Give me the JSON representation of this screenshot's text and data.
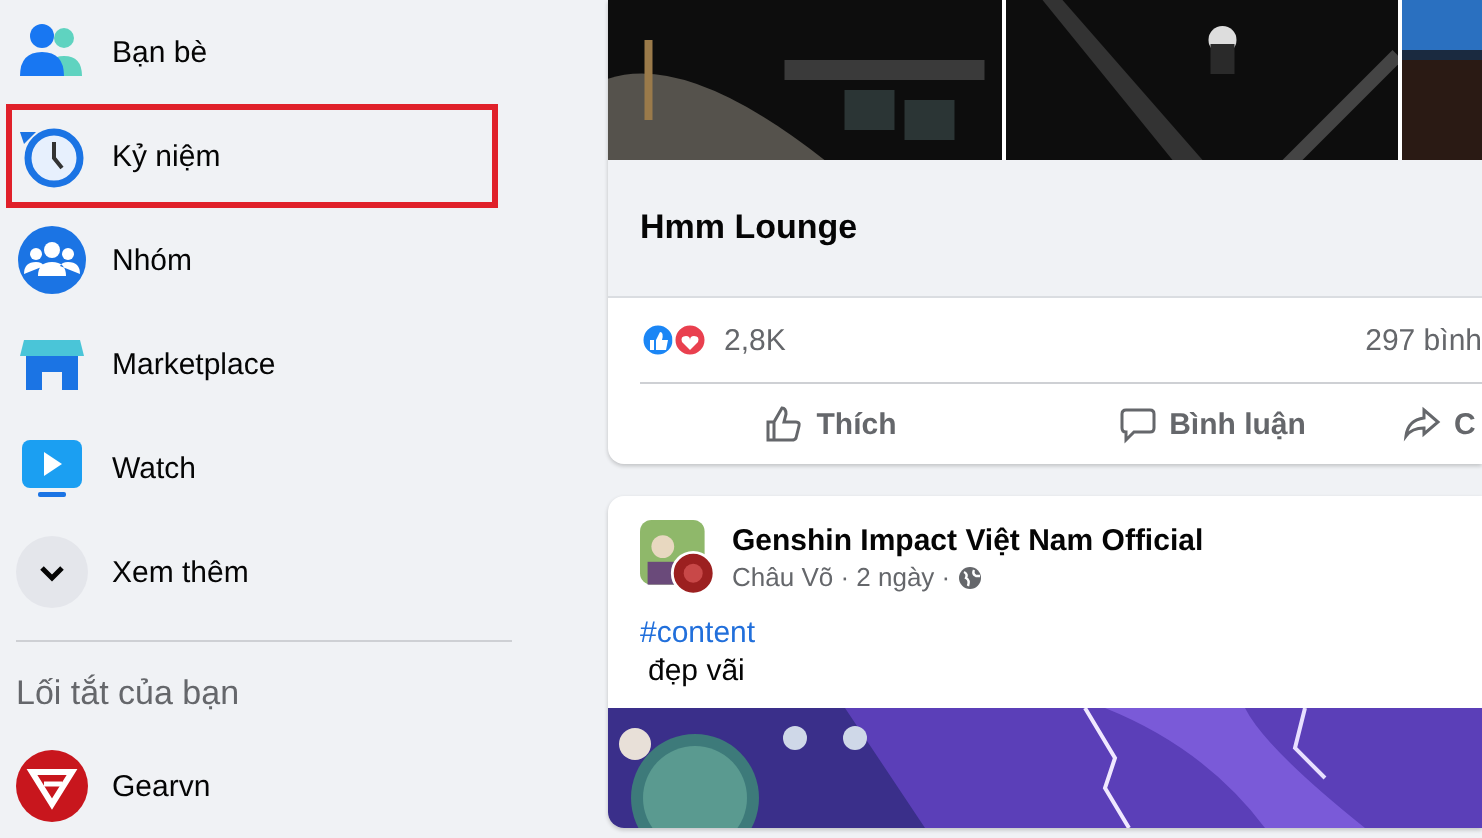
{
  "sidebar": {
    "items": [
      {
        "label": "Bạn bè",
        "highlighted": false
      },
      {
        "label": "Kỷ niệm",
        "highlighted": true
      },
      {
        "label": "Nhóm",
        "highlighted": false
      },
      {
        "label": "Marketplace",
        "highlighted": false
      },
      {
        "label": "Watch",
        "highlighted": false
      },
      {
        "label": "Xem thêm",
        "highlighted": false
      }
    ],
    "shortcuts_heading": "Lối tắt của bạn",
    "shortcuts": [
      {
        "label": "Gearvn"
      }
    ]
  },
  "posts": [
    {
      "kind": "album",
      "title": "Hmm Lounge",
      "reaction_count": "2,8K",
      "comment_count": "297 bình",
      "actions": [
        {
          "label": "Thích"
        },
        {
          "label": "Bình luận"
        },
        {
          "label": "C"
        }
      ]
    },
    {
      "kind": "status",
      "page": "Genshin Impact Việt Nam Official",
      "byline": "Châu Võ · 2 ngày ·",
      "hashtag": "#content",
      "text": "đẹp vãi"
    }
  ]
}
